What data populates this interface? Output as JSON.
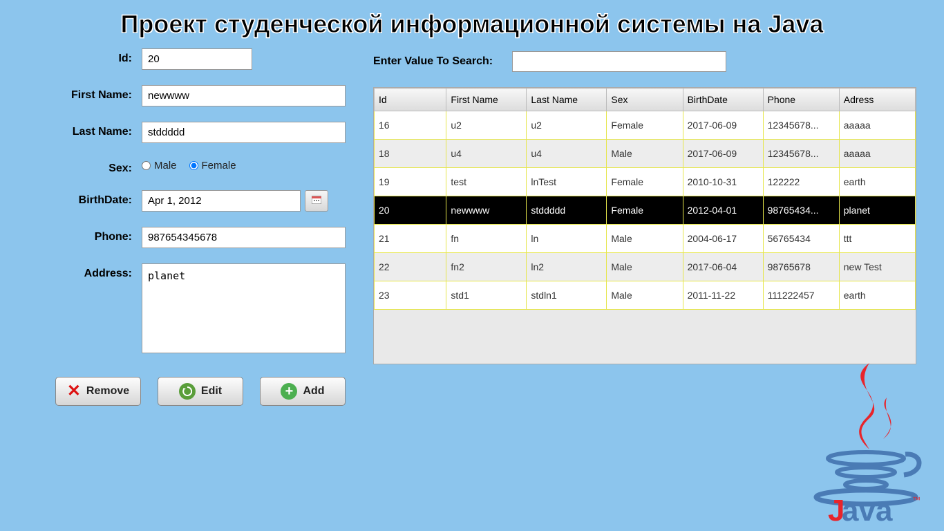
{
  "title": "Проект студенческой информационной системы на Java",
  "form": {
    "labels": {
      "id": "Id:",
      "first_name": "First Name:",
      "last_name": "Last Name:",
      "sex": "Sex:",
      "birthdate": "BirthDate:",
      "phone": "Phone:",
      "address": "Address:"
    },
    "values": {
      "id": "20",
      "first_name": "newwww",
      "last_name": "stddddd",
      "birthdate": "Apr 1, 2012",
      "phone": "987654345678",
      "address": "planet"
    },
    "sex_options": {
      "male": "Male",
      "female": "Female"
    },
    "sex_selected": "female"
  },
  "buttons": {
    "remove": "Remove",
    "edit": "Edit",
    "add": "Add"
  },
  "search": {
    "label": "Enter Value To Search:",
    "value": ""
  },
  "table": {
    "headers": [
      "Id",
      "First Name",
      "Last Name",
      "Sex",
      "BirthDate",
      "Phone",
      "Adress"
    ],
    "selected_id": "20",
    "rows": [
      {
        "id": "16",
        "fn": "u2",
        "ln": "u2",
        "sex": "Female",
        "bd": "2017-06-09",
        "ph": "12345678...",
        "ad": "aaaaa",
        "alt": false
      },
      {
        "id": "18",
        "fn": "u4",
        "ln": "u4",
        "sex": "Male",
        "bd": "2017-06-09",
        "ph": "12345678...",
        "ad": "aaaaa",
        "alt": true
      },
      {
        "id": "19",
        "fn": "test",
        "ln": "lnTest",
        "sex": "Female",
        "bd": "2010-10-31",
        "ph": "122222",
        "ad": "earth",
        "alt": false
      },
      {
        "id": "20",
        "fn": "newwww",
        "ln": "stddddd",
        "sex": "Female",
        "bd": "2012-04-01",
        "ph": "98765434...",
        "ad": "planet",
        "alt": true
      },
      {
        "id": "21",
        "fn": "fn",
        "ln": "ln",
        "sex": "Male",
        "bd": "2004-06-17",
        "ph": "56765434",
        "ad": "ttt",
        "alt": false
      },
      {
        "id": "22",
        "fn": "fn2",
        "ln": "ln2",
        "sex": "Male",
        "bd": "2017-06-04",
        "ph": "98765678",
        "ad": "new Test",
        "alt": true
      },
      {
        "id": "23",
        "fn": "std1",
        "ln": "stdln1",
        "sex": "Male",
        "bd": "2011-11-22",
        "ph": "111222457",
        "ad": "earth",
        "alt": false
      }
    ]
  },
  "logo": {
    "text": "Java"
  }
}
